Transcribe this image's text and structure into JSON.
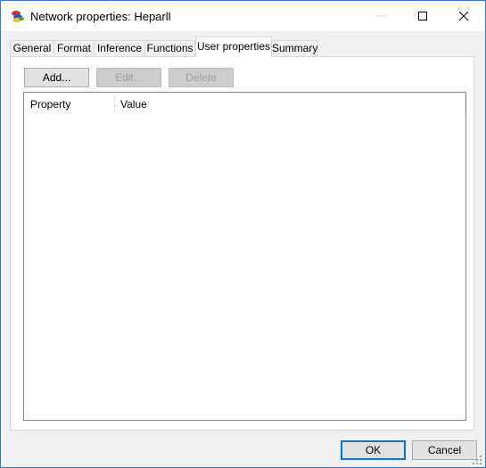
{
  "window": {
    "title": "Network properties: Heparll",
    "app_icon": "network-app-icon",
    "controls": {
      "minimize_icon": "minimize-icon",
      "maximize_icon": "maximize-icon",
      "close_icon": "close-icon"
    }
  },
  "tabs": [
    {
      "label": "General",
      "active": false
    },
    {
      "label": "Format",
      "active": false
    },
    {
      "label": "Inference",
      "active": false
    },
    {
      "label": "Functions",
      "active": false
    },
    {
      "label": "User properties",
      "active": true
    },
    {
      "label": "Summary",
      "active": false
    }
  ],
  "toolbar": {
    "add_label": "Add...",
    "edit_label": "Edit...",
    "delete_label": "Delete"
  },
  "list": {
    "columns": [
      "Property",
      "Value"
    ],
    "rows": []
  },
  "footer": {
    "ok_label": "OK",
    "cancel_label": "Cancel"
  },
  "colors": {
    "accent": "#0078d7",
    "window_border": "#2b79d6"
  }
}
